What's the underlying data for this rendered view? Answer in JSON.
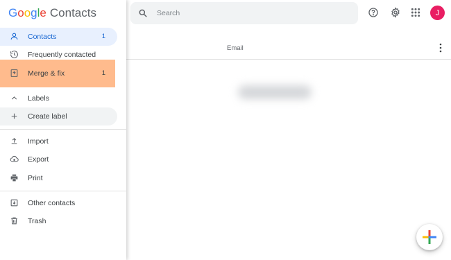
{
  "app": {
    "logo_letters": [
      "G",
      "o",
      "o",
      "g",
      "l",
      "e"
    ],
    "logo_colors": [
      "#4285F4",
      "#EA4335",
      "#FBBC05",
      "#4285F4",
      "#34A853",
      "#EA4335"
    ],
    "product_name": "Contacts"
  },
  "sidebar": {
    "items": [
      {
        "label": "Contacts",
        "count": "1",
        "icon": "person-icon"
      },
      {
        "label": "Frequently contacted",
        "icon": "history-icon"
      },
      {
        "label": "Merge & fix",
        "count": "1",
        "icon": "merge-fix-icon"
      },
      {
        "label": "Labels",
        "icon": "chevron-up-icon"
      },
      {
        "label": "Create label",
        "icon": "plus-icon"
      },
      {
        "label": "Import",
        "icon": "upload-icon"
      },
      {
        "label": "Export",
        "icon": "cloud-download-icon"
      },
      {
        "label": "Print",
        "icon": "print-icon"
      },
      {
        "label": "Other contacts",
        "icon": "download-box-icon"
      },
      {
        "label": "Trash",
        "icon": "trash-icon"
      }
    ]
  },
  "header": {
    "search_placeholder": "Search",
    "avatar_initial": "J"
  },
  "main": {
    "column_email": "Email"
  },
  "colors": {
    "accent": "#1967d2",
    "active_bg": "#e8f0fe",
    "highlight": "#ffbb8d",
    "avatar": "#e91e63"
  }
}
